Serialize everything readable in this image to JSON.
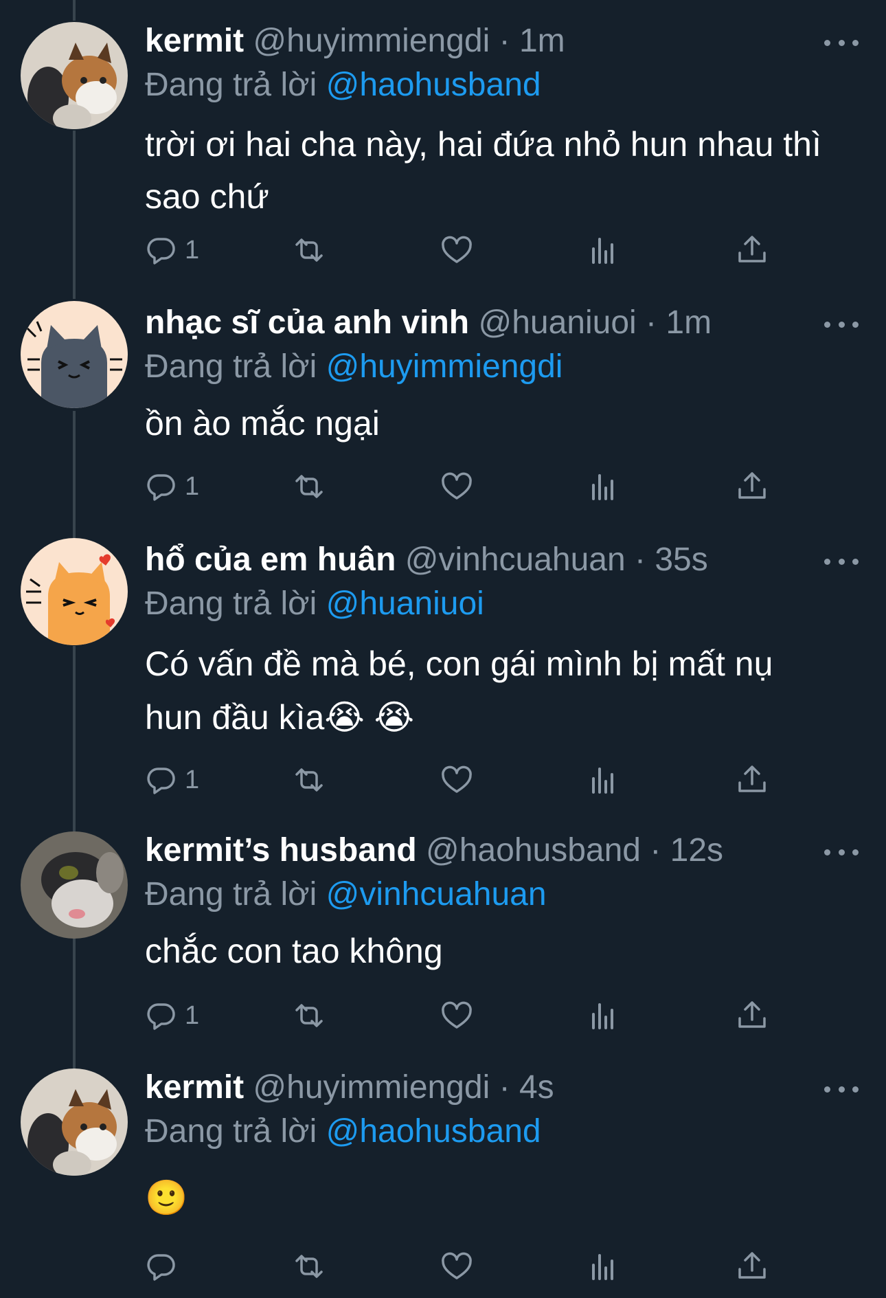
{
  "reply_prefix": "Đang trả lời",
  "colors": {
    "background": "#15202b",
    "secondary_text": "#8b98a5",
    "link": "#1d9bf0",
    "thread_line": "#38444d"
  },
  "icons": [
    "reply-icon",
    "retweet-icon",
    "like-icon",
    "views-icon",
    "share-icon",
    "more-icon"
  ],
  "tweets": [
    {
      "name": "kermit",
      "handle": "@huyimmiengdi",
      "sep": "·",
      "time": "1m",
      "reply_to": "@haohusband",
      "text": "trời ơi hai cha này, hai đứa nhỏ hun nhau thì sao chứ",
      "reply_count": "1"
    },
    {
      "name": "nhạc sĩ của anh vinh",
      "handle": "@huaniuoi",
      "sep": "·",
      "time": "1m",
      "reply_to": "@huyimmiengdi",
      "text": "ồn ào mắc ngại",
      "reply_count": "1"
    },
    {
      "name": "hổ của em huân",
      "handle": "@vinhcuahuan",
      "sep": "·",
      "time": "35s",
      "reply_to": "@huaniuoi",
      "text": "Có vấn đề mà bé, con gái mình bị mất nụ hun đầu kìa",
      "emojis": "😭 😭",
      "reply_count": "1"
    },
    {
      "name": "kermit’s husband",
      "handle": "@haohusband",
      "sep": "·",
      "time": "12s",
      "reply_to": "@vinhcuahuan",
      "text": "chắc con tao không",
      "reply_count": "1"
    },
    {
      "name": "kermit",
      "handle": "@huyimmiengdi",
      "sep": "·",
      "time": "4s",
      "reply_to": "@haohusband",
      "text": "🙂",
      "reply_count": ""
    }
  ]
}
